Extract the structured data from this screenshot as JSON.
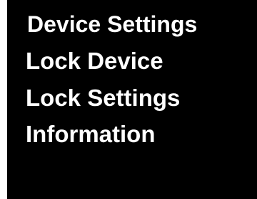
{
  "screen": {
    "title": "Device Settings",
    "menu_items": [
      "Lock Device",
      "Lock Settings",
      "Information"
    ]
  },
  "colors": {
    "background": "#000000",
    "text": "#ffffff",
    "frame": "#ffffff"
  }
}
